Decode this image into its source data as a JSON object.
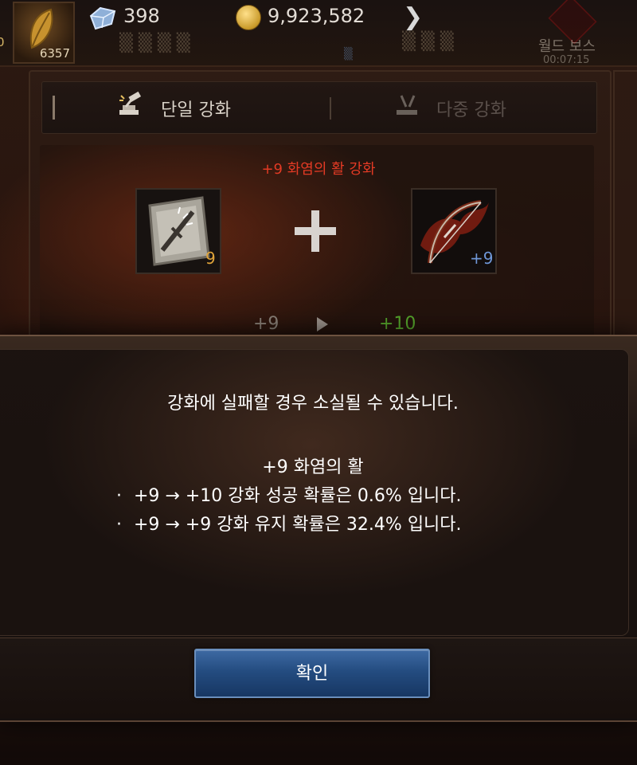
{
  "top_bar": {
    "edge_value": "0",
    "leaf_count": "6357",
    "gem_count": "398",
    "gold_amount": "9,923,582",
    "world_boss_label": "월드 보스",
    "world_boss_timer": "00:07:15"
  },
  "tabs": {
    "single_label": "단일 강화",
    "multi_label": "다중 강화"
  },
  "enhance": {
    "title": "+9 화염의 활 강화",
    "material_count": "9",
    "target_level": "+9",
    "from_level": "+9",
    "to_level": "+10"
  },
  "dialog": {
    "warning": "강화에 실패할 경우 소실될 수 있습니다.",
    "item_name": "+9 화염의 활",
    "bullet": "·",
    "success_rate_text": "+9 → +10 강화 성공 확률은 0.6% 입니다.",
    "keep_rate_text": "+9 → +9 강화 유지 확률은 32.4% 입니다.",
    "confirm_label": "확인"
  },
  "icons": {
    "leaf": "leaf-icon",
    "gem": "gem-icon",
    "coin": "gold-coin-icon",
    "chevron": "chevron-right-icon",
    "hammer": "hammer-icon",
    "scroll": "enhancement-scroll-icon",
    "bow": "flame-bow-icon",
    "plus": "plus-icon"
  },
  "colors": {
    "title_red": "#e23a24",
    "material_count": "#e0a43a",
    "bow_level_blue": "#6f97d8",
    "next_level_green": "#56a62c",
    "confirm_blue": "#244c80"
  }
}
